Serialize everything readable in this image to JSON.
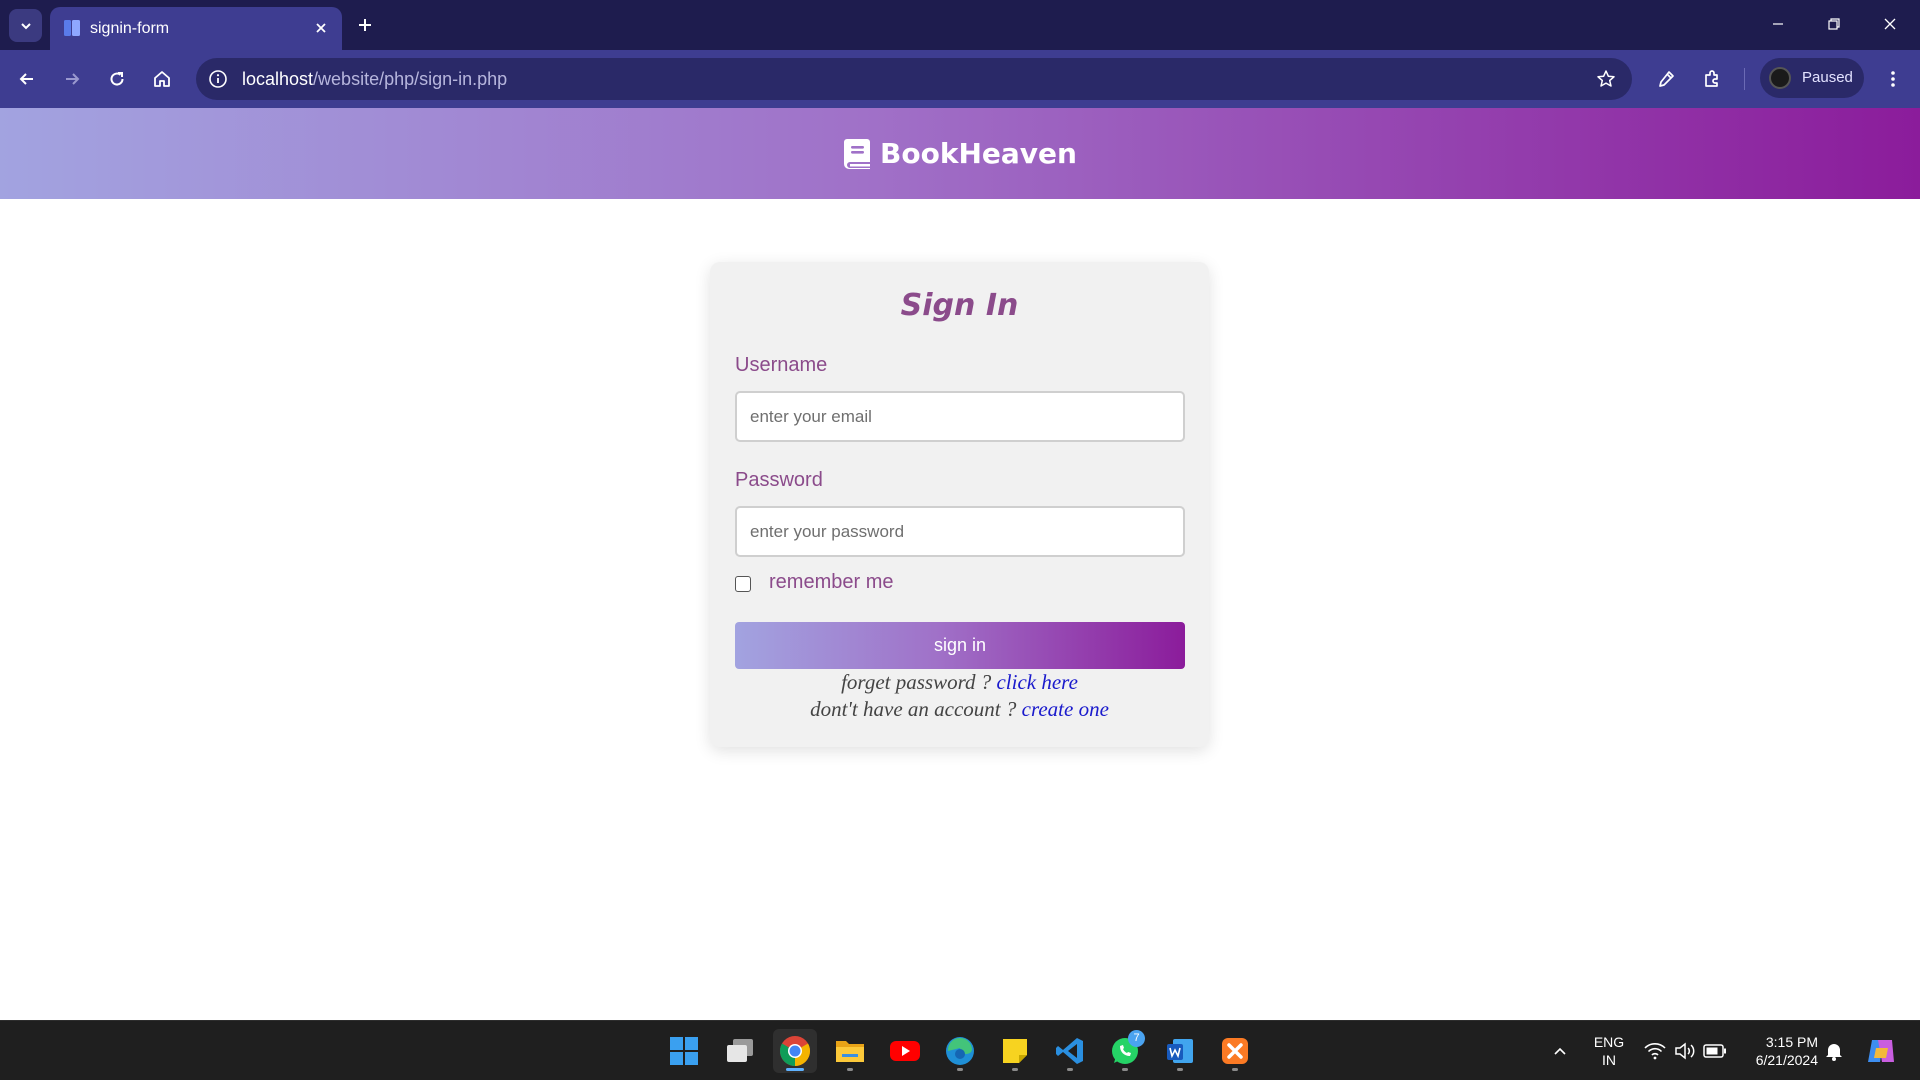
{
  "browser": {
    "tab_title": "signin-form",
    "url_host": "localhost",
    "url_path": "/website/php/sign-in.php",
    "profile_label": "Paused",
    "icons": [
      "tab-list-icon",
      "favicon-book-icon",
      "close-icon",
      "plus-icon",
      "minimize-icon",
      "restore-icon",
      "window-close-icon",
      "back-arrow-icon",
      "forward-arrow-icon",
      "reload-icon",
      "home-icon",
      "site-info-icon",
      "star-icon",
      "eyedropper-icon",
      "extensions-icon",
      "more-vertical-icon"
    ]
  },
  "site": {
    "brand": "BookHeaven",
    "brand_icon": "book-icon",
    "gradient": [
      "#a2a3e0",
      "#a071c8",
      "#8b1c9b"
    ]
  },
  "form": {
    "title": "Sign In",
    "username_label": "Username",
    "username_placeholder": "enter your email",
    "password_label": "Password",
    "password_placeholder": "enter your password",
    "remember_label": "remember me",
    "remember_checked": false,
    "submit_label": "sign in",
    "forgot_text": "forget password ? ",
    "forgot_link": "click here",
    "signup_text": "dont't have an account ? ",
    "signup_link": "create one",
    "accent_color": "#8b4b8b",
    "link_color": "#1a1acc"
  },
  "taskbar": {
    "apps": [
      "start",
      "task-view",
      "chrome",
      "file-explorer",
      "youtube",
      "edge",
      "sticky-notes",
      "vscode",
      "whatsapp",
      "word",
      "xampp"
    ],
    "whatsapp_badge": "7",
    "lang_top": "ENG",
    "lang_bottom": "IN",
    "time": "3:15 PM",
    "date": "6/21/2024"
  }
}
